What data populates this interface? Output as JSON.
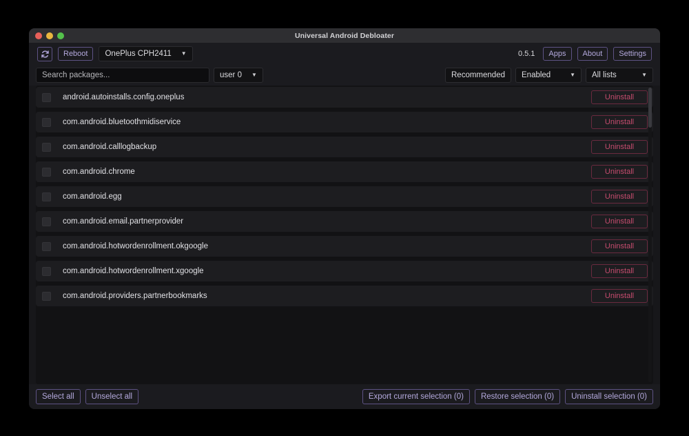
{
  "window": {
    "title": "Universal Android Debloater",
    "traffic_lights": [
      "close",
      "minimize",
      "maximize"
    ]
  },
  "toolbar": {
    "refresh_icon": "refresh-icon",
    "reboot_label": "Reboot",
    "device": "OnePlus CPH2411",
    "version": "0.5.1",
    "apps_label": "Apps",
    "about_label": "About",
    "settings_label": "Settings"
  },
  "filters": {
    "search_placeholder": "Search packages...",
    "search_value": "",
    "user": "user 0",
    "recommendation": "Recommended",
    "state": "Enabled",
    "list": "All lists"
  },
  "packages": {
    "uninstall_label": "Uninstall",
    "rows": [
      {
        "name": "android.autoinstalls.config.oneplus",
        "checked": false
      },
      {
        "name": "com.android.bluetoothmidiservice",
        "checked": false
      },
      {
        "name": "com.android.calllogbackup",
        "checked": false
      },
      {
        "name": "com.android.chrome",
        "checked": false
      },
      {
        "name": "com.android.egg",
        "checked": false
      },
      {
        "name": "com.android.email.partnerprovider",
        "checked": false
      },
      {
        "name": "com.android.hotwordenrollment.okgoogle",
        "checked": false
      },
      {
        "name": "com.android.hotwordenrollment.xgoogle",
        "checked": false
      },
      {
        "name": "com.android.providers.partnerbookmarks",
        "checked": false
      }
    ]
  },
  "bottom_bar": {
    "select_all_label": "Select all",
    "unselect_all_label": "Unselect all",
    "export_label": "Export current selection (0)",
    "restore_label": "Restore selection (0)",
    "uninstall_selection_label": "Uninstall selection (0)"
  },
  "colors": {
    "accent": "#b4a9dd",
    "accent_border": "#5e5385",
    "danger": "#c64c6e",
    "danger_border": "#6b2a3f",
    "window_bg": "#17171a",
    "panel_bg": "#1b1b1f",
    "list_bg": "#121214",
    "row_bg": "#1d1d20",
    "title_bar_bg": "#2e2e31",
    "text": "#e2e2e6"
  }
}
